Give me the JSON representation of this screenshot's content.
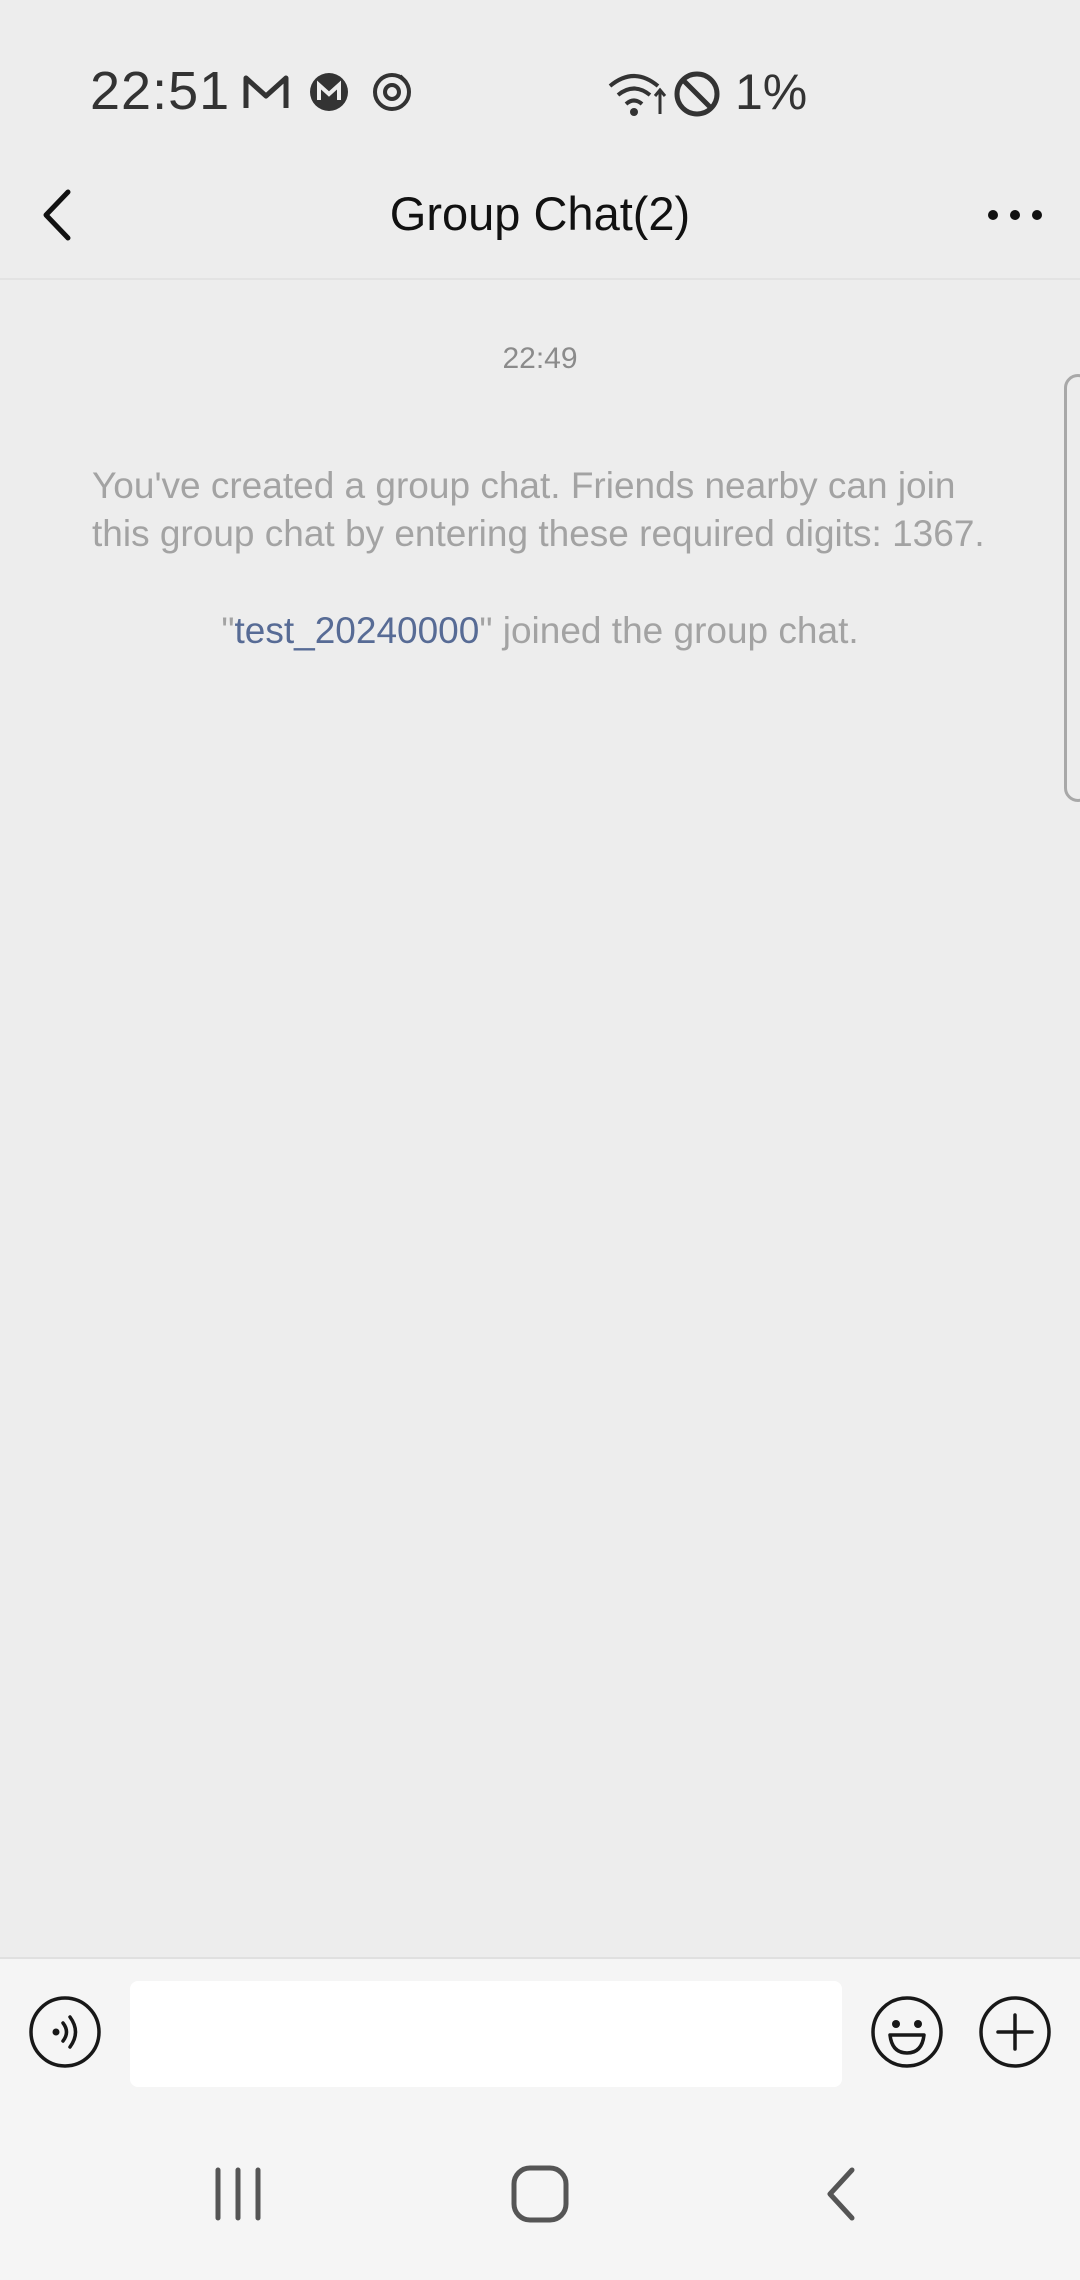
{
  "status_bar": {
    "time": "22:51",
    "battery": "1%",
    "icons": [
      "gmail-icon",
      "mastodon-icon",
      "sync-icon",
      "wifi-icon",
      "do-not-disturb-icon"
    ]
  },
  "header": {
    "title": "Group Chat(2)",
    "back_icon": "chevron-left-icon",
    "more_icon": "more-icon"
  },
  "chat": {
    "timestamp": "22:49",
    "system_message": "You've created a group chat. Friends nearby can join this group chat by entering these required digits: 1367.",
    "join_prefix": "\"",
    "join_user": "test_20240000",
    "join_suffix": "\" joined the group chat."
  },
  "input_bar": {
    "value": "",
    "placeholder": "",
    "voice_icon": "voice-icon",
    "emoji_icon": "emoji-icon",
    "plus_icon": "plus-icon"
  },
  "system_nav": {
    "icons": [
      "recent-apps-icon",
      "home-icon",
      "back-icon"
    ]
  },
  "colors": {
    "background": "#ededed",
    "link": "#576b95",
    "system_text": "#a3a3a3"
  }
}
